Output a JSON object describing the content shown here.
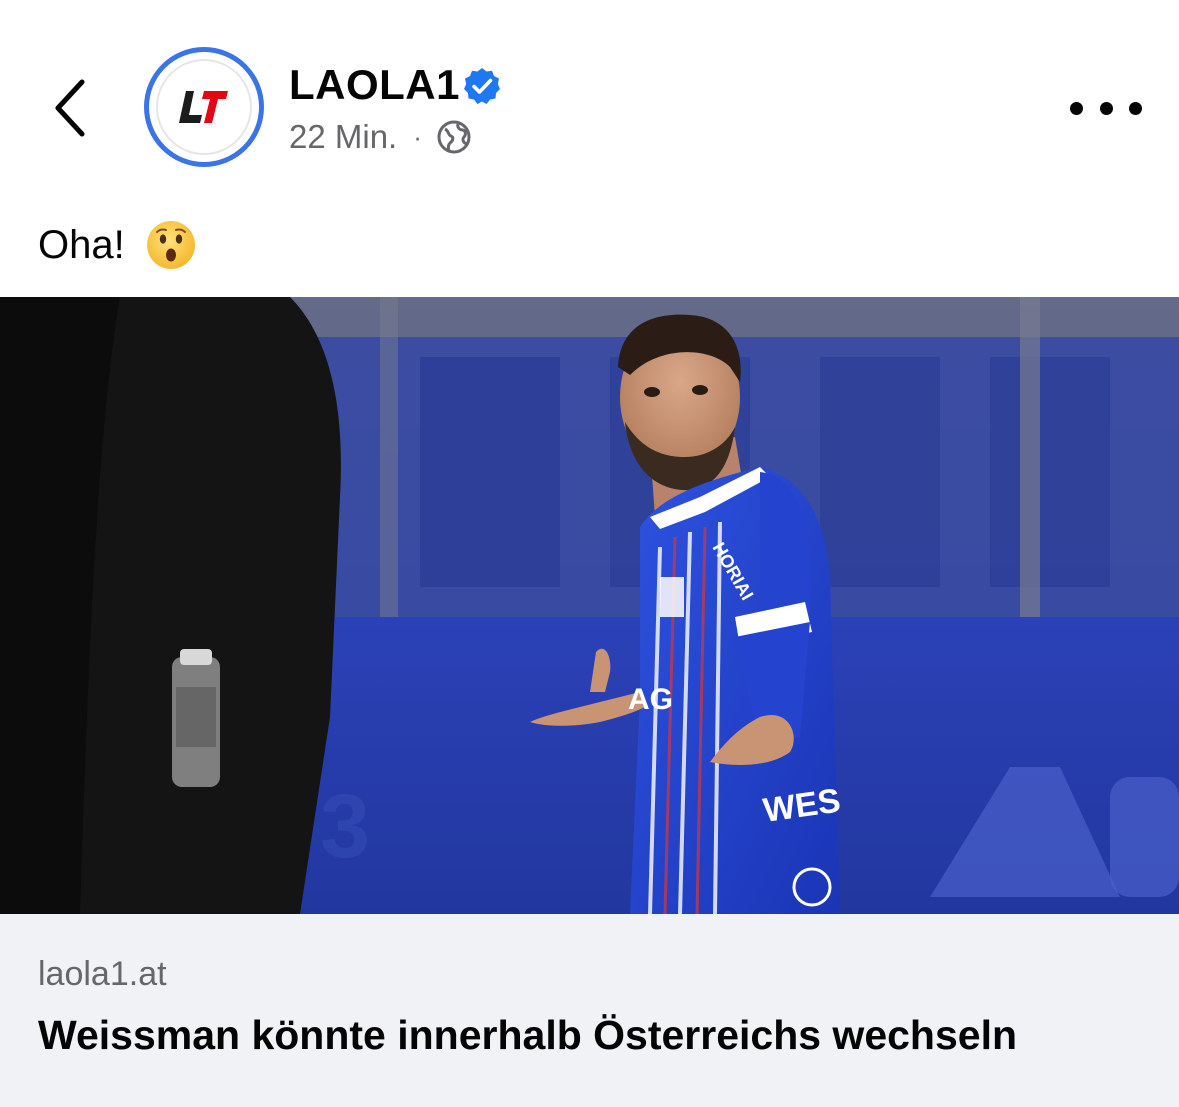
{
  "header": {
    "page_name": "LAOLA1",
    "avatar_text": "L1",
    "timestamp": "22 Min.",
    "separator": "·",
    "verified": true
  },
  "post": {
    "caption": "Oha!",
    "emoji": "astonished-face-emoji"
  },
  "link_preview": {
    "domain": "laola1.at",
    "title": "Weissman könnte innerhalb Österreichs wechseln"
  },
  "colors": {
    "verified_blue": "#1d78f2",
    "avatar_ring": "#3b74e8",
    "meta_gray": "#65676b",
    "preview_bg": "#f0f2f5",
    "jersey_blue": "#1f3fc8"
  },
  "icons": {
    "back": "chevron-left-icon",
    "verified": "verified-badge-icon",
    "privacy": "globe-icon",
    "more": "more-horizontal-icon"
  }
}
